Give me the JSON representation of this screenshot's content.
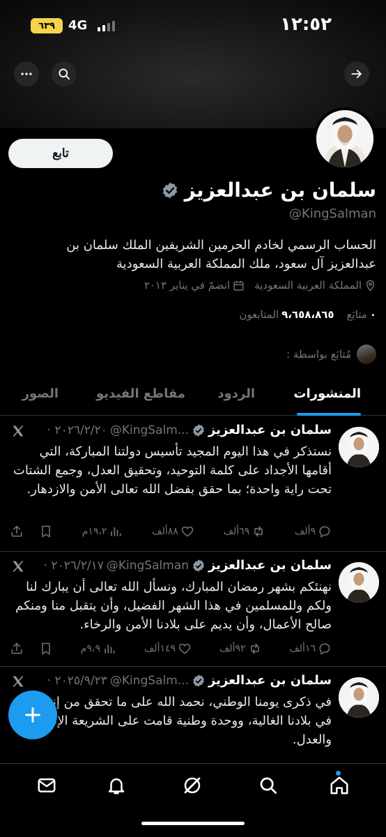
{
  "status_bar": {
    "time": "١٢:٥٢",
    "battery": "٦٣٩",
    "network": "4G"
  },
  "header": {
    "back_icon": "arrow-right-icon",
    "search_icon": "search-icon",
    "more_icon": "more-icon"
  },
  "profile": {
    "follow_label": "تابع",
    "name": "سلمان بن عبدالعزيز",
    "handle": "@KingSalman",
    "bio": "الحساب الرسمي لخادم الحرمين الشريفين الملك سلمان بن عبدالعزيز آل سعود، ملك المملكة العربية السعودية",
    "location": "المملكة العربية السعودية",
    "joined": "انضمّ في يناير ٢٠١٣",
    "following_count": "٠",
    "following_label": "متابَع",
    "followers_count": "٩،٦٥٨،٨٦٥",
    "followers_label": "المتابعون",
    "followed_by": "مُتابَع بواسطة :",
    "verified_color": "#8b98a5"
  },
  "tabs": [
    "المنشورات",
    "الردود",
    "مقاطع الفيديو",
    "الصور"
  ],
  "tweets": [
    {
      "name": "سلمان بن عبدالعزيز",
      "handle": "@KingSalm...",
      "date": "٢٠٢٦/٢/٢٠ ·",
      "text": "نستذكر في هذا اليوم المجيد تأسيس دولتنا المباركة، التي أقامها الأجداد على كلمة التوحيد، وتحقيق العدل، وجمع الشتات تحت راية واحدة؛ بما حقق بفضل الله تعالى الأمن والازدهار.",
      "replies": "٩ألف",
      "reposts": "٦٩ألف",
      "likes": "٨٨ألف",
      "views": "١٩،٢م"
    },
    {
      "name": "سلمان بن عبدالعزيز",
      "handle": "@KingSalman",
      "date": "٢٠٢٦/٢/١٧ ·",
      "text": "نهنئكم بشهر رمضان المبارك، ونسأل الله تعالى أن يبارك لنا ولكم وللمسلمين في هذا الشهر الفضيل، وأن يتقبل منا ومنكم صالح الأعمال، وأن يديم على بلادنا الأمن والرخاء.",
      "replies": "١٦ألف",
      "reposts": "٩٢ألف",
      "likes": "١٤٩ألف",
      "views": "٩،٩م"
    },
    {
      "name": "سلمان بن عبدالعزيز",
      "handle": "@KingSalm...",
      "date": "٢٠٢٥/٩/٢٣ ·",
      "text": "في ذكرى يومنا الوطني، نحمد الله على ما تحقق من إنجازات في بلادنا الغالية، ووحدة وطنية قامت على الشريعة الإسلامية والعدل."
    }
  ],
  "fab": {
    "icon": "plus-icon"
  },
  "bottom_nav": [
    "home-icon",
    "search-icon",
    "grok-icon",
    "notifications-icon",
    "messages-icon"
  ],
  "colors": {
    "accent": "#1d9bf0",
    "background": "#000000",
    "muted": "#71767b"
  }
}
